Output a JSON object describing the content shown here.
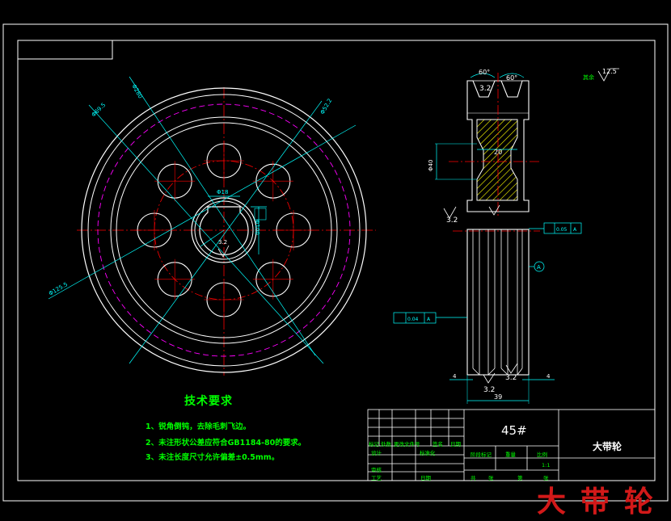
{
  "tech_requirements": {
    "title": "技术要求",
    "items": [
      "1、锐角倒钝，去除毛刺飞边。",
      "2、未注形状公差应符合GB1184-80的要求。",
      "3、未注长度尺寸允许偏差±0.5mm。"
    ]
  },
  "title_block": {
    "material": "45#",
    "part_name": "大带轮",
    "scale": "1:1",
    "cells": {
      "mark": "标记",
      "count": "处数",
      "zone": "分区",
      "change_doc": "更改文件号",
      "signature": "签名",
      "date": "日期",
      "design": "设计",
      "standardize": "标准化",
      "stage_mark": "阶段标记",
      "weight": "重量",
      "ratio": "比例",
      "review": "审核",
      "process": "工艺",
      "approve": "日期",
      "total": "共",
      "sheets": "张",
      "sheet_no": "第",
      "sheet_unit": "张"
    }
  },
  "dimensions": {
    "front_view": [
      "Φ280",
      "Φ69.5",
      "Φ52.2",
      "Φ125.5",
      "Φ100",
      "Φ18",
      "3.2"
    ],
    "section_view": {
      "angle_left": "60°",
      "angle_right": "60°",
      "groove_roughness": "3.2",
      "hub_width": "20",
      "bore_dia": "Φ40",
      "roughness_left": "3.2",
      "roughness_bottom_left": "3.2",
      "roughness_bottom_right": "3.2",
      "width_total": "39",
      "offset_left": "4",
      "offset_right": "4",
      "tolerance_perp": "0.05",
      "tolerance_par": "0.04",
      "datum": "A",
      "other_roughness_label": "其余",
      "other_roughness": "12.5"
    }
  },
  "watermark": "大带轮",
  "colors": {
    "background": "#000000",
    "border": "#ffffff",
    "geometry": "#ffffff",
    "centerline": "#ff0000",
    "pitch_circle": "#ff00ff",
    "dimension": "#00ffff",
    "section_hatch": "#ffff00",
    "text": "#00ff00",
    "watermark": "#d21919"
  }
}
